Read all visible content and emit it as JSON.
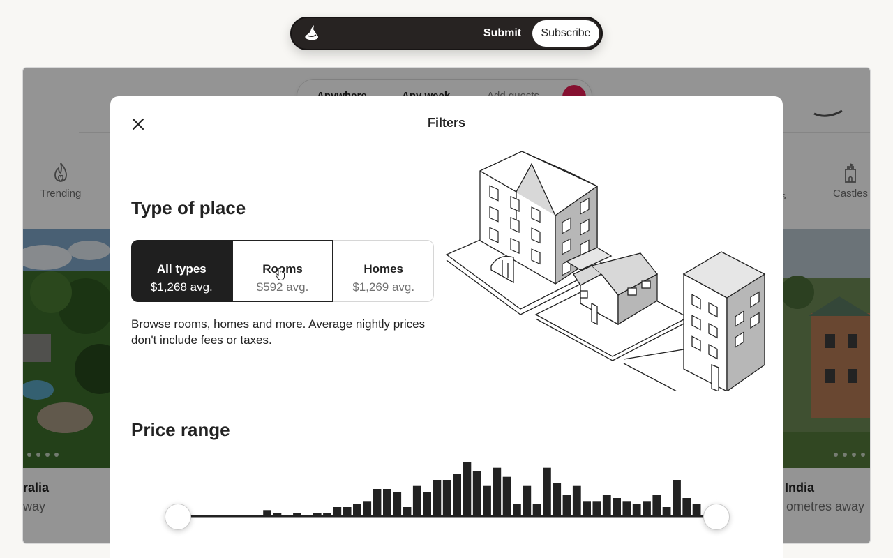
{
  "topbar": {
    "logo_icon": "witch-hat-icon",
    "submit_label": "Submit",
    "subscribe_label": "Subscribe"
  },
  "site": {
    "search": {
      "where": "Anywhere",
      "when": "Any week",
      "guests_placeholder": "Add guests"
    },
    "categories": [
      {
        "label": "Trending",
        "icon": "flame-icon"
      },
      {
        "label": "Castles",
        "icon": "castle-icon"
      }
    ],
    "partial_category_suffix": "s",
    "listing_left": {
      "title": "ralia",
      "subtitle": "way"
    },
    "listing_right": {
      "title": "India",
      "subtitle": "ometres away"
    }
  },
  "modal": {
    "title": "Filters",
    "type_of_place": {
      "heading": "Type of place",
      "options": [
        {
          "label": "All types",
          "price": "$1,268 avg.",
          "selected": true
        },
        {
          "label": "Rooms",
          "price": "$592 avg.",
          "selected": false
        },
        {
          "label": "Homes",
          "price": "$1,269 avg.",
          "selected": false
        }
      ],
      "description": "Browse rooms, homes and more. Average nightly prices don't include fees or taxes."
    },
    "price_range": {
      "heading": "Price range",
      "histogram": [
        0,
        0,
        0,
        0,
        0,
        0,
        0,
        2,
        1,
        0,
        1,
        0,
        1,
        1,
        3,
        3,
        4,
        5,
        9,
        9,
        8,
        3,
        10,
        8,
        12,
        12,
        14,
        18,
        15,
        10,
        16,
        13,
        4,
        10,
        4,
        16,
        11,
        7,
        10,
        5,
        5,
        7,
        6,
        5,
        4,
        5,
        7,
        3,
        12,
        6,
        4
      ],
      "slider_min_fraction": 0,
      "slider_max_fraction": 1
    }
  }
}
